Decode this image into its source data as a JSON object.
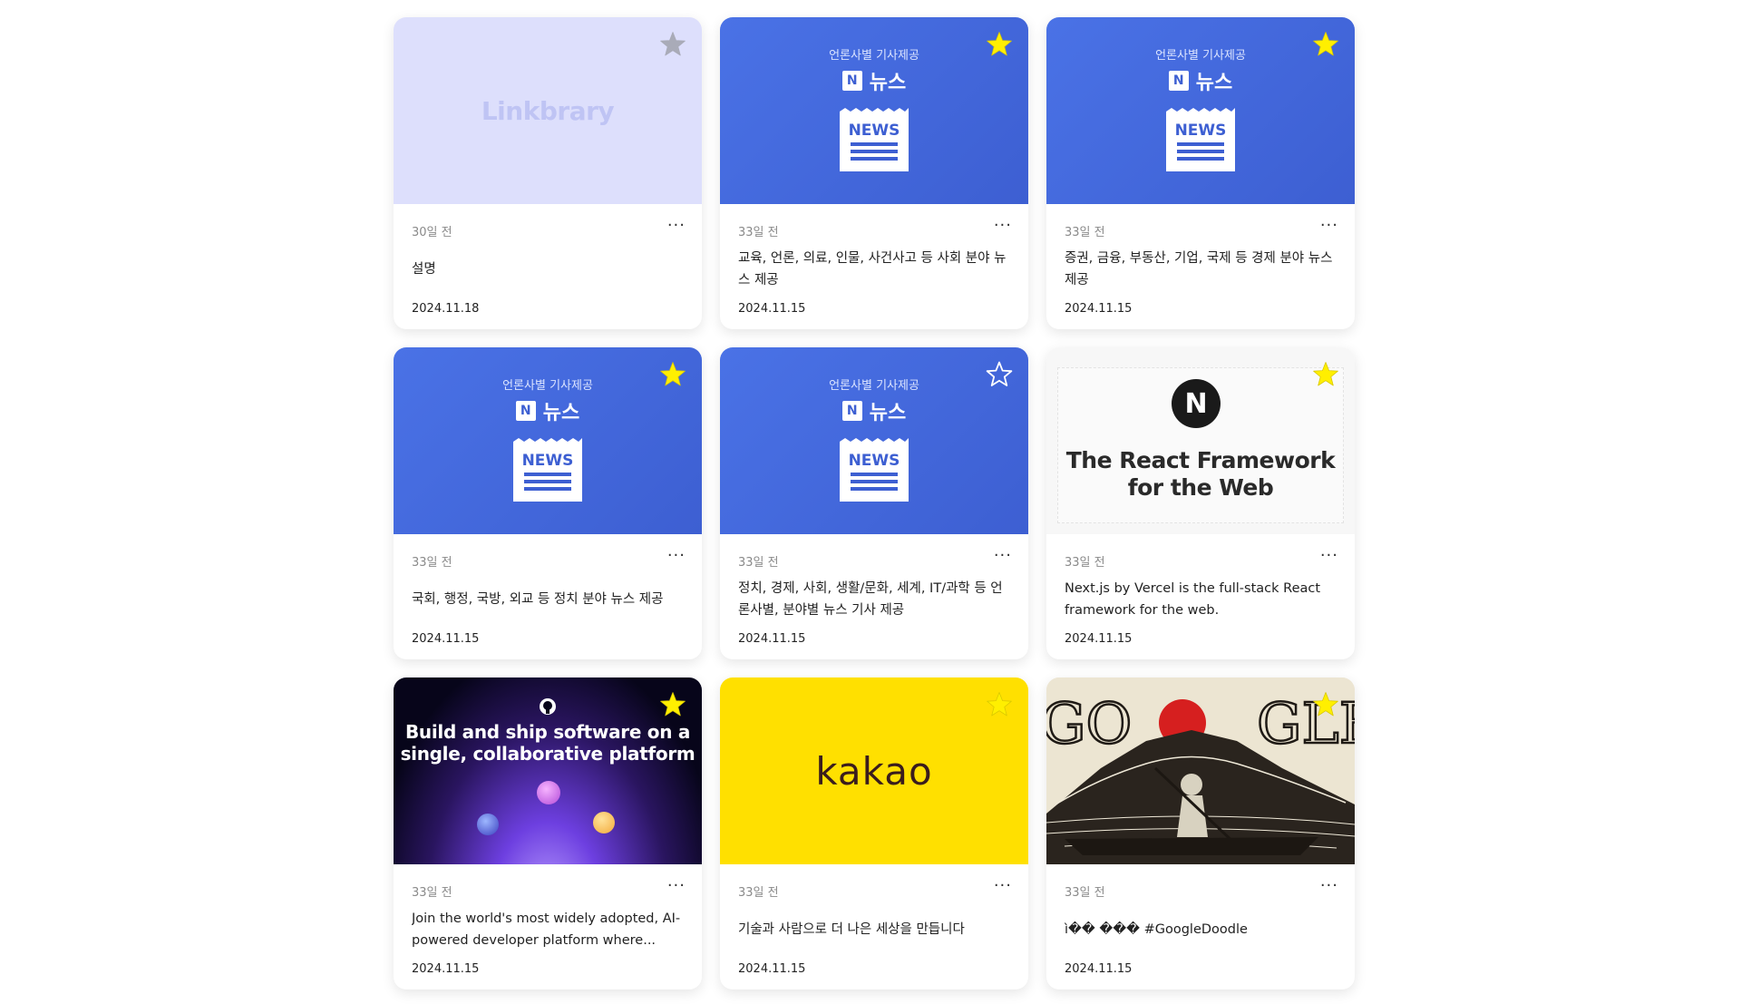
{
  "colors": {
    "star_active": "#ffef00",
    "star_inactive_linkbrary": "#a9abb8",
    "naver_blue": "#4169e1",
    "kakao_yellow": "#ffe000"
  },
  "icons": {
    "star": "star-icon",
    "kebab": "kebab-menu-icon",
    "naver_n": "naver-n-logo-icon",
    "newspaper": "newspaper-icon",
    "github": "github-icon"
  },
  "naver_thumb": {
    "subtitle": "언론사별 기사제공",
    "n_letter": "N",
    "brand": "뉴스",
    "paper_label": "NEWS"
  },
  "cards": [
    {
      "thumb_type": "linkbrary",
      "thumb_text": "Linkbrary",
      "favorite": false,
      "star_style": "filled-gray",
      "age": "30일 전",
      "menu": "···",
      "description": "설명",
      "date": "2024.11.18"
    },
    {
      "thumb_type": "naver",
      "favorite": true,
      "age": "33일 전",
      "menu": "···",
      "description": "교육, 언론, 의료, 인물, 사건사고 등 사회 분야 뉴스 제공",
      "date": "2024.11.15"
    },
    {
      "thumb_type": "naver",
      "favorite": true,
      "age": "33일 전",
      "menu": "···",
      "description": "증권, 금융, 부동산, 기업, 국제 등 경제 분야 뉴스 제공",
      "date": "2024.11.15"
    },
    {
      "thumb_type": "naver",
      "favorite": true,
      "age": "33일 전",
      "menu": "···",
      "description": "국회, 행정, 국방, 외교 등 정치 분야 뉴스 제공",
      "date": "2024.11.15"
    },
    {
      "thumb_type": "naver",
      "favorite": false,
      "star_style": "outline",
      "age": "33일 전",
      "menu": "···",
      "description": "정치, 경제, 사회, 생활/문화, 세계, IT/과학 등 언론사별, 분야별 뉴스 기사 제공",
      "date": "2024.11.15"
    },
    {
      "thumb_type": "nextjs",
      "thumb_logo": "N",
      "thumb_text": "The React Framework for the Web",
      "favorite": true,
      "age": "33일 전",
      "menu": "···",
      "description": "Next.js by Vercel is the full-stack React framework for the web.",
      "date": "2024.11.15"
    },
    {
      "thumb_type": "github",
      "thumb_text": "Build and ship software on a single, collaborative platform",
      "favorite": true,
      "age": "33일 전",
      "menu": "···",
      "description": "Join the world's most widely adopted, AI-powered developer platform where...",
      "date": "2024.11.15"
    },
    {
      "thumb_type": "kakao",
      "thumb_text": "kakao",
      "favorite": true,
      "age": "33일 전",
      "menu": "···",
      "description": "기술과 사람으로 더 나은 세상을 만듭니다",
      "date": "2024.11.15"
    },
    {
      "thumb_type": "doodle",
      "favorite": true,
      "age": "33일 전",
      "menu": "···",
      "description": "ì�� ��� #GoogleDoodle",
      "date": "2024.11.15"
    }
  ]
}
